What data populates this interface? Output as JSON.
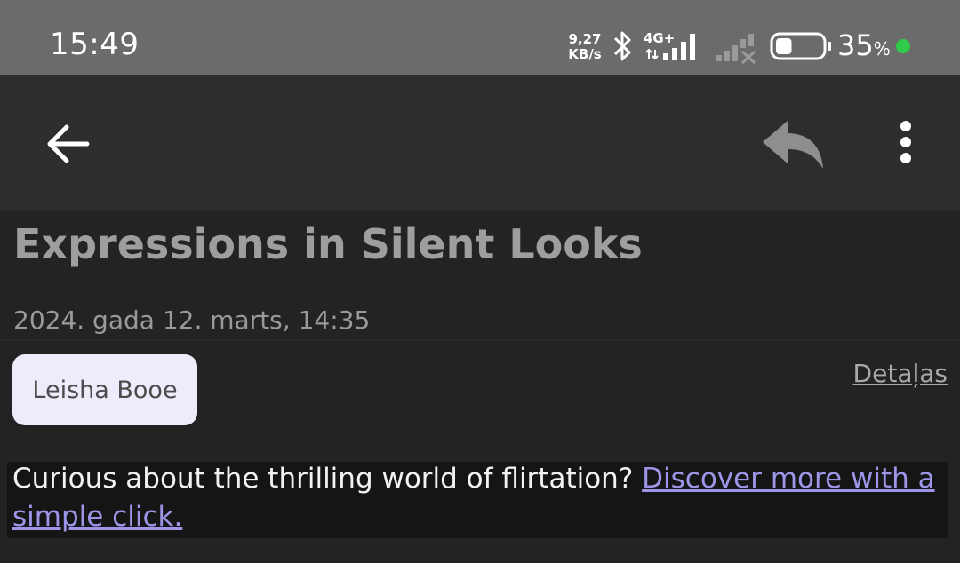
{
  "status_bar": {
    "time": "15:49",
    "net_speed_value": "9,27",
    "net_speed_unit": "KB/s",
    "network_type": "4G+",
    "battery_percent": "35",
    "battery_unit": "%",
    "battery_level": 0.35,
    "icons": [
      "bluetooth-icon",
      "signal-4g-icon",
      "signal-no-service-icon",
      "battery-icon",
      "dot-indicator-icon"
    ]
  },
  "app_bar": {
    "icons": [
      "back-arrow-icon",
      "reply-icon",
      "more-vertical-icon"
    ]
  },
  "email": {
    "subject": "Expressions in Silent Looks",
    "date": "2024. gada 12. marts, 14:35",
    "sender": "Leisha Booe",
    "details_label": "Detaļas",
    "body_text": "Curious about the thrilling world of flirtation? ",
    "body_link": "Discover more with a simple click."
  },
  "colors": {
    "status_bar_bg": "#6b6b6b",
    "app_bar_bg": "#2d2d2d",
    "page_bg": "#232323",
    "chip_bg": "#eeecfb",
    "link": "#9d96e8",
    "battery_dot": "#2ecc4a"
  }
}
